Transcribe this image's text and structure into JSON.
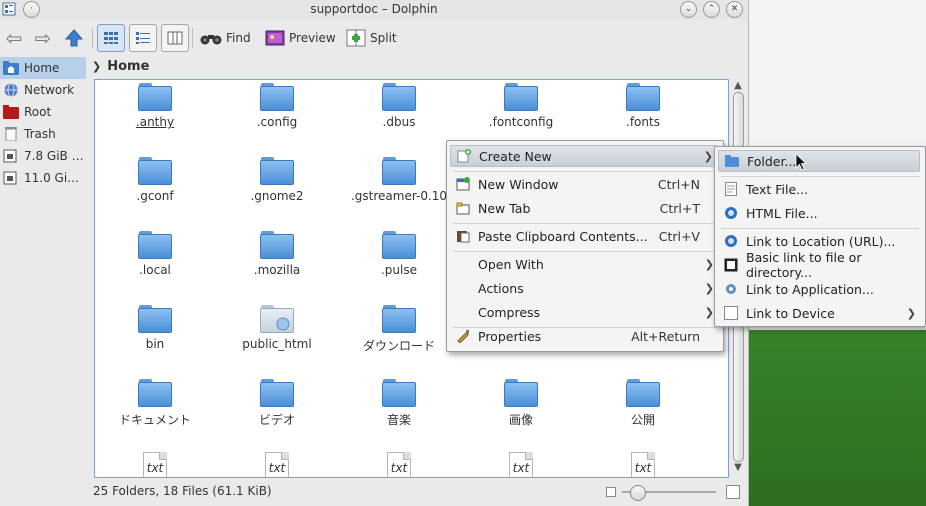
{
  "window": {
    "title": "supportdoc – Dolphin"
  },
  "toolbar": {
    "find_label": "Find",
    "preview_label": "Preview",
    "split_label": "Split"
  },
  "sidebar": {
    "items": [
      {
        "label": "Home",
        "icon": "home-folder-icon",
        "color": "#3d7cc9"
      },
      {
        "label": "Network",
        "icon": "network-icon",
        "color": "#4d79c4"
      },
      {
        "label": "Root",
        "icon": "root-folder-icon",
        "color": "#b21b1b"
      },
      {
        "label": "Trash",
        "icon": "trash-icon",
        "color": "#8c8c8c"
      },
      {
        "label": "7.8 GiB …",
        "icon": "drive-icon",
        "color": "#555555"
      },
      {
        "label": "11.0 Gi…",
        "icon": "drive-icon",
        "color": "#555555"
      }
    ]
  },
  "breadcrumb": {
    "location": "Home"
  },
  "files": {
    "rows": [
      [
        ".anthy",
        ".config",
        ".dbus",
        ".fontconfig",
        ".fonts"
      ],
      [
        ".gconf",
        ".gnome2",
        ".gstreamer-0.10",
        "",
        ""
      ],
      [
        ".local",
        ".mozilla",
        ".pulse",
        "",
        ""
      ],
      [
        "bin",
        "public_html",
        "ダウンロード",
        "",
        ""
      ],
      [
        "ドキュメント",
        "ビデオ",
        "音楽",
        "画像",
        "公開"
      ]
    ],
    "txt_icon_label": "txt"
  },
  "status": {
    "summary": "25 Folders, 18 Files (61.1 KiB)"
  },
  "context_menu": {
    "items": [
      {
        "label": "Create New",
        "shortcut": "",
        "submenu": true,
        "highlight": true
      },
      {
        "label": "New Window",
        "shortcut": "Ctrl+N"
      },
      {
        "label": "New Tab",
        "shortcut": "Ctrl+T"
      },
      {
        "label": "Paste Clipboard Contents...",
        "shortcut": "Ctrl+V"
      },
      {
        "label": "Open With",
        "shortcut": "",
        "submenu": true
      },
      {
        "label": "Actions",
        "shortcut": "",
        "submenu": true
      },
      {
        "label": "Compress",
        "shortcut": "",
        "submenu": true
      },
      {
        "label": "Properties",
        "shortcut": "Alt+Return"
      }
    ]
  },
  "create_new_menu": {
    "items": [
      {
        "label": "Folder..."
      },
      {
        "label": "Text File..."
      },
      {
        "label": "HTML File..."
      },
      {
        "label": "Link to Location (URL)..."
      },
      {
        "label": "Basic link to file or directory..."
      },
      {
        "label": "Link to Application..."
      },
      {
        "label": "Link to Device",
        "submenu": true
      }
    ]
  },
  "colors": {
    "selection": "#b7cfe9",
    "folder_blue": "#4a8fd8",
    "desktop_green": "#3c8a2e"
  }
}
